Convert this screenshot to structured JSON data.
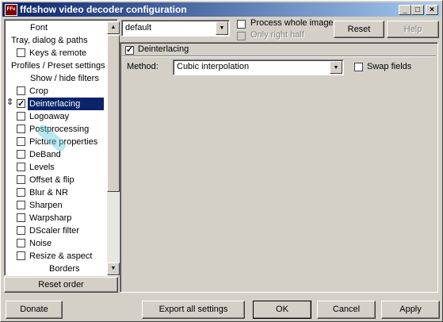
{
  "window": {
    "title": "ffdshow video decoder configuration",
    "icon_text": "FFv",
    "minimize_glyph": "_",
    "maximize_glyph": "□",
    "close_glyph": "×"
  },
  "tree": {
    "items": [
      {
        "label": "Font",
        "checkbox": false,
        "indent": 1
      },
      {
        "label": "Tray, dialog & paths",
        "checkbox": false,
        "indent": 0
      },
      {
        "label": "Keys & remote",
        "checkbox": true,
        "checked": false,
        "indent": 1
      },
      {
        "label": "Profiles / Preset settings",
        "checkbox": false,
        "indent": 0
      },
      {
        "label": "Show / hide filters",
        "checkbox": false,
        "indent": 1
      },
      {
        "label": "Crop",
        "checkbox": true,
        "checked": false,
        "indent": 1
      },
      {
        "label": "Deinterlacing",
        "checkbox": true,
        "checked": true,
        "indent": 1,
        "selected": true
      },
      {
        "label": "Logoaway",
        "checkbox": true,
        "checked": false,
        "indent": 1
      },
      {
        "label": "Postprocessing",
        "checkbox": true,
        "checked": false,
        "indent": 1
      },
      {
        "label": "Picture properties",
        "checkbox": true,
        "checked": false,
        "indent": 1
      },
      {
        "label": "DeBand",
        "checkbox": true,
        "checked": false,
        "indent": 1
      },
      {
        "label": "Levels",
        "checkbox": true,
        "checked": false,
        "indent": 1
      },
      {
        "label": "Offset & flip",
        "checkbox": true,
        "checked": false,
        "indent": 1
      },
      {
        "label": "Blur & NR",
        "checkbox": true,
        "checked": false,
        "indent": 1
      },
      {
        "label": "Sharpen",
        "checkbox": true,
        "checked": false,
        "indent": 1
      },
      {
        "label": "Warpsharp",
        "checkbox": true,
        "checked": false,
        "indent": 1
      },
      {
        "label": "DScaler filter",
        "checkbox": true,
        "checked": false,
        "indent": 1
      },
      {
        "label": "Noise",
        "checkbox": true,
        "checked": false,
        "indent": 1
      },
      {
        "label": "Resize & aspect",
        "checkbox": true,
        "checked": false,
        "indent": 1
      },
      {
        "label": "Borders",
        "checkbox": false,
        "indent": 2
      }
    ],
    "reorder_glyph": "⇕",
    "scroll_up": "▲",
    "scroll_down": "▼"
  },
  "reset_order_label": "Reset order",
  "preset": {
    "value": "default",
    "arrow": "▼"
  },
  "process_whole_image": {
    "label": "Process whole image",
    "checked": false
  },
  "only_right_half": {
    "label": "Only right half",
    "checked": false,
    "enabled": false
  },
  "reset_label": "Reset",
  "help_label": "Help",
  "deinterlacing": {
    "enable_label": "Deinterlacing",
    "enabled": true,
    "method_label": "Method:",
    "method_value": "Cubic interpolation",
    "swap_fields_label": "Swap fields",
    "swap_fields": false
  },
  "footer": {
    "donate": "Donate",
    "export": "Export all settings",
    "ok": "OK",
    "cancel": "Cancel",
    "apply": "Apply"
  }
}
